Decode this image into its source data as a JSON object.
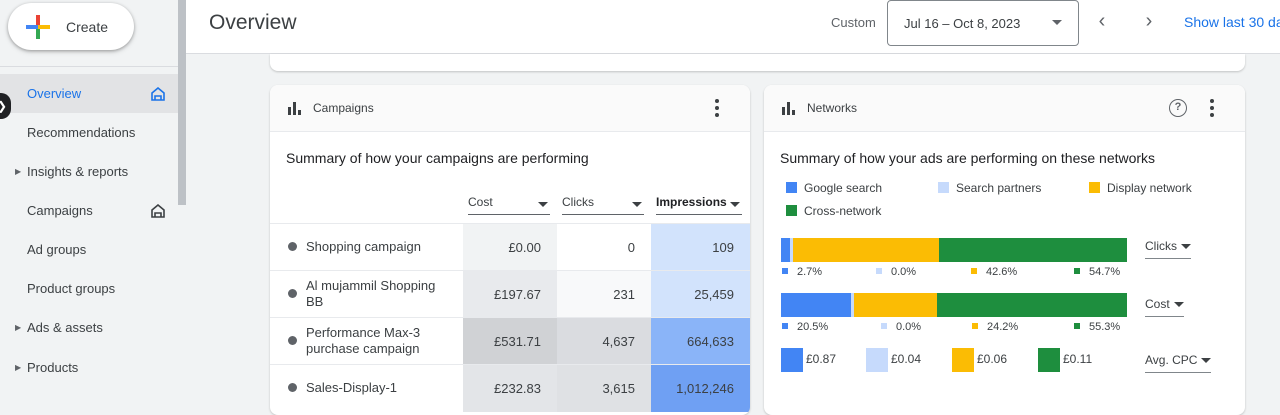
{
  "sidebar": {
    "create_label": "Create",
    "items": [
      {
        "label": "Overview",
        "caret": false,
        "home": true,
        "active": true
      },
      {
        "label": "Recommendations",
        "caret": false,
        "home": false
      },
      {
        "label": "Insights & reports",
        "caret": true,
        "home": false
      },
      {
        "label": "Campaigns",
        "caret": false,
        "home": true
      },
      {
        "label": "Ad groups",
        "caret": false,
        "home": false
      },
      {
        "label": "Product groups",
        "caret": false,
        "home": false
      },
      {
        "label": "Ads & assets",
        "caret": true,
        "home": false
      },
      {
        "label": "Products",
        "caret": true,
        "home": false
      }
    ]
  },
  "header": {
    "title": "Overview",
    "custom_label": "Custom",
    "date_range": "Jul 16 – Oct 8, 2023",
    "show_last": "Show last 30 da"
  },
  "campaigns": {
    "title": "Campaigns",
    "summary": "Summary of how your campaigns are performing",
    "columns": [
      "Cost",
      "Clicks",
      "Impressions"
    ],
    "rows": [
      {
        "name": "Shopping campaign",
        "cost": "£0.00",
        "clicks": "0",
        "impressions": "109"
      },
      {
        "name": "Al mujammil Shopping BB",
        "cost": "£197.67",
        "clicks": "231",
        "impressions": "25,459"
      },
      {
        "name": "Performance Max-3 purchase campaign",
        "cost": "£531.71",
        "clicks": "4,637",
        "impressions": "664,633"
      },
      {
        "name": "Sales-Display-1",
        "cost": "£232.83",
        "clicks": "3,615",
        "impressions": "1,012,246"
      }
    ]
  },
  "networks": {
    "title": "Networks",
    "summary": "Summary of how your ads are performing on these networks",
    "legend": [
      {
        "label": "Google search",
        "color": "#4285f4"
      },
      {
        "label": "Search partners",
        "color": "#c6dafc"
      },
      {
        "label": "Display network",
        "color": "#fbbc04"
      },
      {
        "label": "Cross-network",
        "color": "#1e8e3e"
      }
    ],
    "bars": [
      {
        "metric": "Clicks",
        "shares": [
          2.7,
          0.0,
          42.6,
          54.7
        ],
        "labels": [
          "2.7%",
          "0.0%",
          "42.6%",
          "54.7%"
        ]
      },
      {
        "metric": "Cost",
        "shares": [
          20.5,
          0.0,
          24.2,
          55.3
        ],
        "labels": [
          "20.5%",
          "0.0%",
          "24.2%",
          "55.3%"
        ]
      }
    ],
    "avg_cpc": {
      "metric": "Avg. CPC",
      "values": [
        "£0.87",
        "£0.04",
        "£0.06",
        "£0.11"
      ]
    }
  }
}
